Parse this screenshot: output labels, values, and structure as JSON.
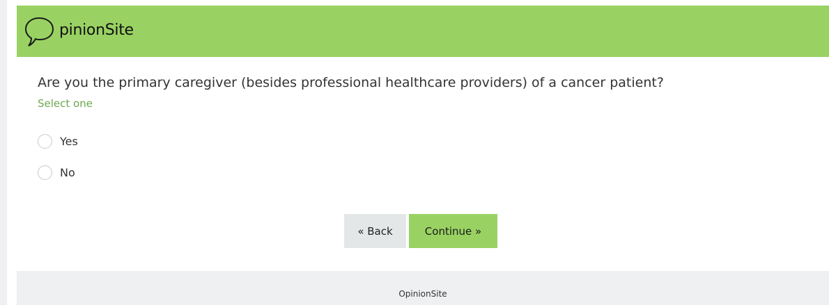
{
  "header": {
    "logo_text": "pinionSite",
    "logo_letter": "O",
    "background_color": "#99d262"
  },
  "question": {
    "text": "Are you the primary caregiver (besides professional healthcare providers) of a cancer patient?",
    "hint": "Select one",
    "hint_color": "#6aa84f",
    "options": [
      {
        "label": "Yes",
        "selected": false
      },
      {
        "label": "No",
        "selected": false
      }
    ]
  },
  "buttons": {
    "back_label": "« Back",
    "continue_label": "Continue »"
  },
  "footer": {
    "text": "OpinionSite"
  }
}
